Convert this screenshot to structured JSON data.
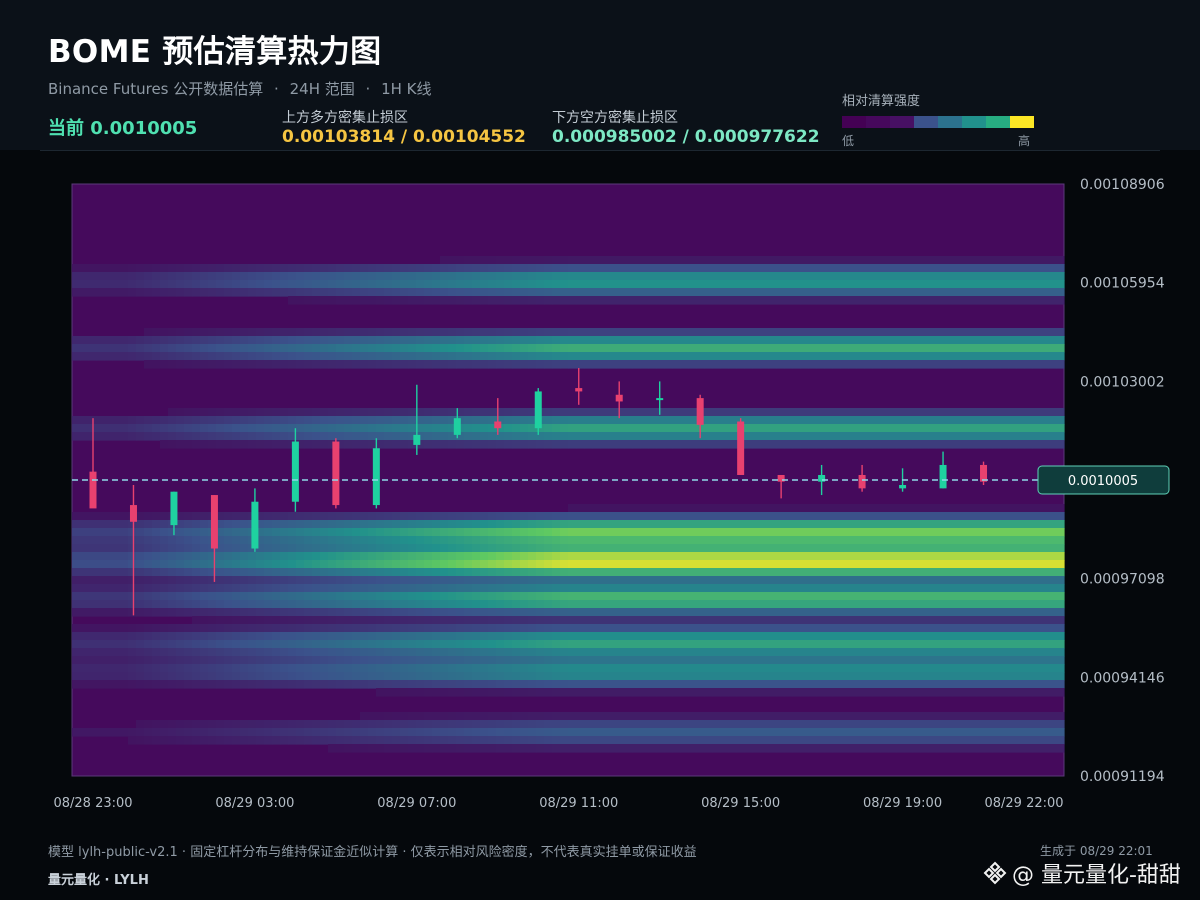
{
  "header": {
    "title": "BOME 预估清算热力图",
    "subtitle_source": "Binance Futures 公开数据估算",
    "subtitle_range": "24H 范围",
    "subtitle_interval": "1H K线",
    "subtitle_separator": "·",
    "current_label": "当前",
    "current_value": "0.0010005",
    "upper_zone_label": "上方多方密集止损区",
    "upper_zone_value": "0.00103814 / 0.00104552",
    "lower_zone_label": "下方空方密集止损区",
    "lower_zone_value": "0.000985002 / 0.000977622",
    "legend_title": "相对清算强度",
    "legend_low": "低",
    "legend_high": "高"
  },
  "colors": {
    "upper_zone": "#f5c542",
    "lower_zone": "#7de8c4",
    "current": "#4fe0b0",
    "candle_up": "#1fd1a0",
    "candle_down": "#e8416f",
    "price_line": "#8fd9e8",
    "legend": [
      "#440154",
      "#46085c",
      "#471063",
      "#3b528b",
      "#2c728e",
      "#21918c",
      "#27ad81",
      "#fde725"
    ]
  },
  "chart_data": {
    "type": "heatmap",
    "title": "",
    "xlabel": "",
    "ylabel": "",
    "ylim": [
      0.00091194,
      0.00108906
    ],
    "x_ticks": [
      "08/28 23:00",
      "08/29 03:00",
      "08/29 07:00",
      "08/29 11:00",
      "08/29 15:00",
      "08/29 19:00",
      "08/29 22:00"
    ],
    "y_ticks": [
      "0.00108906",
      "0.00105954",
      "0.00103002",
      "0.00100050",
      "0.00097098",
      "0.00094146",
      "0.00091194"
    ],
    "y_ticks_shown": [
      "0.00108906",
      "0.00105954",
      "0.00103002",
      "0.00097098",
      "0.00094146",
      "0.00091194"
    ],
    "current_price": 0.0010005,
    "current_price_label": "0.0010005",
    "candles": [
      {
        "t": "08/28 23:00",
        "o": 0.001003,
        "h": 0.001019,
        "l": 0.000993,
        "c": 0.000992
      },
      {
        "t": "08/29 00:00",
        "o": 0.000993,
        "h": 0.000999,
        "l": 0.00096,
        "c": 0.000988
      },
      {
        "t": "08/29 01:00",
        "o": 0.000987,
        "h": 0.000997,
        "l": 0.000984,
        "c": 0.000997
      },
      {
        "t": "08/29 02:00",
        "o": 0.000996,
        "h": 0.000996,
        "l": 0.00097,
        "c": 0.00098
      },
      {
        "t": "08/29 03:00",
        "o": 0.00098,
        "h": 0.000998,
        "l": 0.000979,
        "c": 0.000994
      },
      {
        "t": "08/29 04:00",
        "o": 0.000994,
        "h": 0.001016,
        "l": 0.000991,
        "c": 0.001012
      },
      {
        "t": "08/29 05:00",
        "o": 0.001012,
        "h": 0.001013,
        "l": 0.000992,
        "c": 0.000993
      },
      {
        "t": "08/29 06:00",
        "o": 0.000993,
        "h": 0.001013,
        "l": 0.000992,
        "c": 0.00101
      },
      {
        "t": "08/29 07:00",
        "o": 0.001011,
        "h": 0.001029,
        "l": 0.001008,
        "c": 0.001014
      },
      {
        "t": "08/29 08:00",
        "o": 0.001014,
        "h": 0.001022,
        "l": 0.001013,
        "c": 0.001019
      },
      {
        "t": "08/29 09:00",
        "o": 0.001018,
        "h": 0.001025,
        "l": 0.001014,
        "c": 0.001016
      },
      {
        "t": "08/29 10:00",
        "o": 0.001016,
        "h": 0.001028,
        "l": 0.001014,
        "c": 0.001027
      },
      {
        "t": "08/29 11:00",
        "o": 0.001028,
        "h": 0.001034,
        "l": 0.001023,
        "c": 0.001027
      },
      {
        "t": "08/29 12:00",
        "o": 0.001026,
        "h": 0.00103,
        "l": 0.001019,
        "c": 0.001024
      },
      {
        "t": "08/29 13:00",
        "o": 0.001025,
        "h": 0.00103,
        "l": 0.00102,
        "c": 0.001025
      },
      {
        "t": "08/29 14:00",
        "o": 0.001025,
        "h": 0.001026,
        "l": 0.001013,
        "c": 0.001017
      },
      {
        "t": "08/29 15:00",
        "o": 0.001018,
        "h": 0.001019,
        "l": 0.001002,
        "c": 0.001002
      },
      {
        "t": "08/29 16:00",
        "o": 0.001002,
        "h": 0.001002,
        "l": 0.000995,
        "c": 0.001
      },
      {
        "t": "08/29 17:00",
        "o": 0.001,
        "h": 0.001005,
        "l": 0.000996,
        "c": 0.001002
      },
      {
        "t": "08/29 18:00",
        "o": 0.001002,
        "h": 0.001005,
        "l": 0.000997,
        "c": 0.000998
      },
      {
        "t": "08/29 19:00",
        "o": 0.000998,
        "h": 0.001004,
        "l": 0.000997,
        "c": 0.000999
      },
      {
        "t": "08/29 20:00",
        "o": 0.000998,
        "h": 0.001009,
        "l": 0.000998,
        "c": 0.001005
      },
      {
        "t": "08/29 21:00",
        "o": 0.001005,
        "h": 0.001006,
        "l": 0.000999,
        "c": 0.001
      }
    ],
    "heat_bands": [
      {
        "price": 0.00106,
        "intensity": 0.55
      },
      {
        "price": 0.00104,
        "intensity": 0.65
      },
      {
        "price": 0.001016,
        "intensity": 0.6
      },
      {
        "price": 0.000985,
        "intensity": 0.8
      },
      {
        "price": 0.000976,
        "intensity": 1.0
      },
      {
        "price": 0.000965,
        "intensity": 0.7
      },
      {
        "price": 0.000952,
        "intensity": 0.6
      },
      {
        "price": 0.000943,
        "intensity": 0.5
      },
      {
        "price": 0.000925,
        "intensity": 0.3
      }
    ]
  },
  "footer": {
    "note": "模型 lylh-public-v2.1 · 固定杠杆分布与维持保证金近似计算 · 仅表示相对风险密度，不代表真实挂单或保证收益",
    "brand": "量元量化 · LYLH",
    "generated": "生成于 08/29 22:01",
    "watermark": "@ 量元量化-甜甜"
  }
}
